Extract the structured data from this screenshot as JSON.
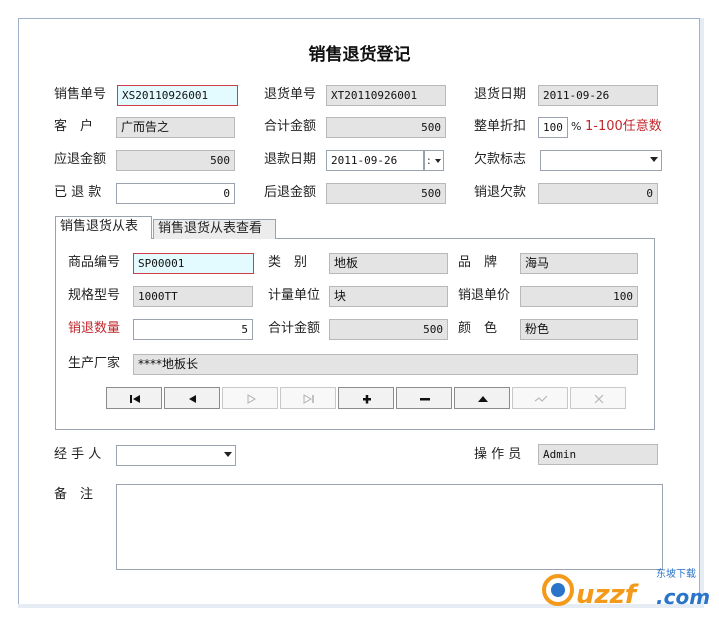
{
  "title": "销售退货登记",
  "form": {
    "sale_no_label": "销售单号",
    "sale_no": "XS20110926001",
    "return_no_label": "退货单号",
    "return_no": "XT20110926001",
    "return_date_label": "退货日期",
    "return_date": "2011-09-26",
    "customer_label": "客　户",
    "customer": "广而告之",
    "total_label": "合计金额",
    "total": "500",
    "discount_label": "整单折扣",
    "discount": "100",
    "discount_pct": "%",
    "discount_hint": "1-100任意数",
    "refund_due_label": "应退金额",
    "refund_due": "500",
    "refund_date_label": "退款日期",
    "refund_date": "2011-09-26",
    "refund_date_sep": ":",
    "debt_flag_label": "欠款标志",
    "debt_flag": "",
    "refunded_label": "已 退 款",
    "refunded": "0",
    "after_refund_label": "后退金额",
    "after_refund": "500",
    "debt_label": "销退欠款",
    "debt": "0",
    "handler_label": "经 手 人",
    "handler": "",
    "operator_label": "操 作 员",
    "operator": "Admin",
    "remark_label": "备　注",
    "remark": ""
  },
  "tabs": [
    "销售退货从表",
    "销售退货从表查看"
  ],
  "detail": {
    "code_label": "商品编号",
    "code": "SP00001",
    "category_label": "类　别",
    "category": "地板",
    "brand_label": "品　牌",
    "brand": "海马",
    "spec_label": "规格型号",
    "spec": "1000TT",
    "unit_label": "计量单位",
    "unit": "块",
    "price_label": "销退单价",
    "price": "100",
    "qty_label": "销退数量",
    "qty": "5",
    "subtotal_label": "合计金额",
    "subtotal": "500",
    "color_label": "颜　色",
    "color": "粉色",
    "maker_label": "生产厂家",
    "maker": "****地板长"
  },
  "navigator": [
    "first-icon",
    "prior-icon",
    "next-icon",
    "last-icon",
    "insert-icon",
    "delete-icon",
    "edit-icon",
    "post-icon",
    "cancel-icon"
  ],
  "watermark": {
    "brand": "uzzf",
    "domain": ".com",
    "tag": "东坡下载"
  },
  "colors": {
    "focus_border": "#cf3c4c",
    "focus_fill": "#e3fbff",
    "hint_red": "#c0282d",
    "readonly_fill": "#e4e4e4",
    "watermark_orange": "#f39a1a",
    "watermark_blue": "#2a74c9"
  }
}
